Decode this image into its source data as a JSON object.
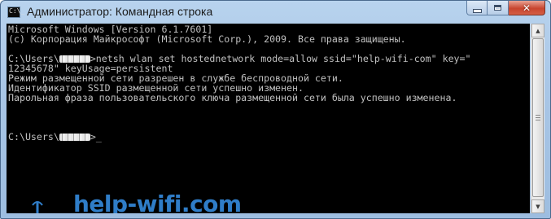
{
  "window": {
    "title": "Администратор: Командная строка",
    "icon": "cmd-icon",
    "icon_text": "C:\\_",
    "controls": {
      "minimize": "minimize-icon",
      "maximize": "maximize-icon",
      "close": "close-icon"
    }
  },
  "console": {
    "lines": [
      "Microsoft Windows [Version 6.1.7601]",
      "(c) Корпорация Майкрософт (Microsoft Corp.), 2009. Все права защищены.",
      "",
      "C:\\Users\\",
      ">netsh wlan set hostednetwork mode=allow ssid=\"help-wifi-com\" key=\"",
      "12345678\" keyUsage=persistent",
      "Режим размещенной сети разрешен в службе беспроводной сети.",
      "Идентификатор SSID размещенной сети успешно изменен.",
      "Парольная фраза пользовательского ключа размещенной сети была успешно изменена.",
      "C:\\Users\\",
      ">",
      "_"
    ],
    "background": "#000000",
    "foreground": "#c0c0c0"
  },
  "watermark": {
    "text": "help-wifi.com",
    "icon": "router-icon",
    "color": "#2f7dc8"
  },
  "scrollbar": {
    "up_icon": "arrow-up-icon",
    "down_icon": "arrow-down-icon",
    "up_glyph": "▲",
    "down_glyph": "▼"
  }
}
